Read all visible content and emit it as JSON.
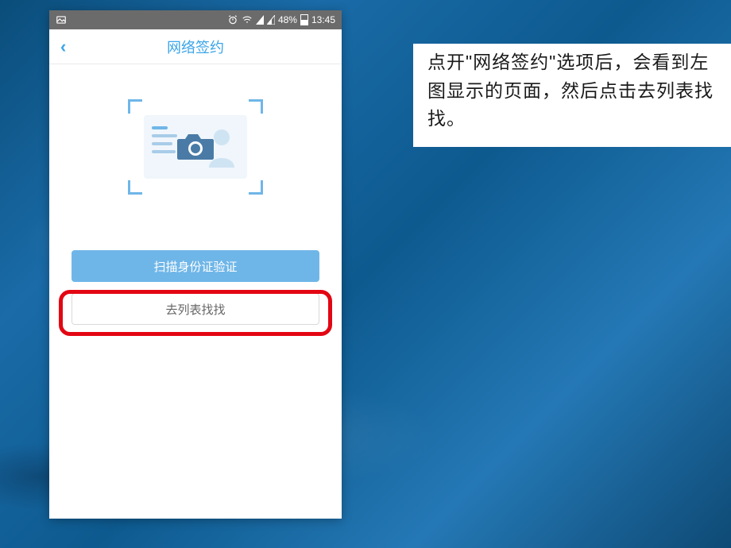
{
  "instruction_text": "点开\"网络签约\"选项后，会看到左图显示的页面，然后点击去列表找找。",
  "phone": {
    "status": {
      "battery_pct": "48%",
      "time": "13:45"
    },
    "nav": {
      "back_glyph": "‹",
      "title": "网络签约"
    },
    "buttons": {
      "scan_label": "扫描身份证验证",
      "list_label": "去列表找找"
    }
  }
}
